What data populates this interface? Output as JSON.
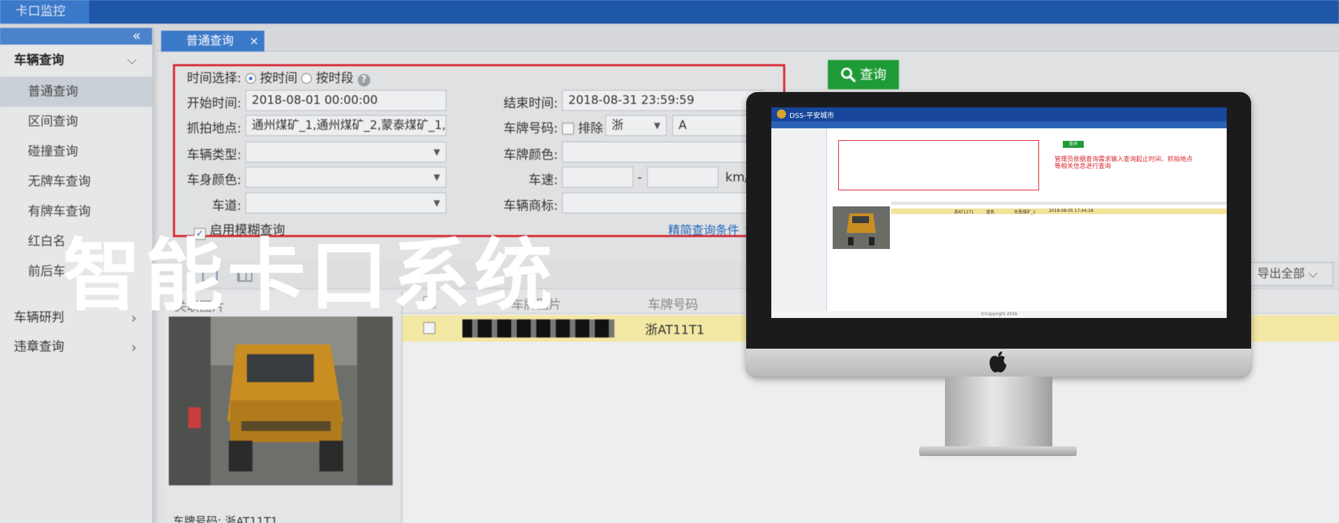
{
  "topbar": {
    "tab": "卡口监控"
  },
  "sidebar": {
    "collapse_icon": "«",
    "group_vehicle_query": "车辆查询",
    "items": [
      "普通查询",
      "区间查询",
      "碰撞查询",
      "无牌车查询",
      "有牌车查询",
      "红白名",
      "前后车"
    ],
    "group_vehicle_control": "车辆研判",
    "group_violation": "违章查询"
  },
  "tabs": {
    "active": "普通查询",
    "close": "×"
  },
  "form": {
    "time_select_label": "时间选择:",
    "radio_by_time": "按时间",
    "radio_by_segment": "按时段",
    "start_label": "开始时间:",
    "start_value": "2018-08-01 00:00:00",
    "end_label": "结束时间:",
    "end_value": "2018-08-31 23:59:59",
    "location_label": "抓拍地点:",
    "location_value": "通州煤矿_1,通州煤矿_2,蒙泰煤矿_1,",
    "plate_label": "车牌号码:",
    "exclude_label": "排除",
    "plate_province": "浙",
    "plate_value": "A",
    "vehicle_type_label": "车辆类型:",
    "plate_color_label": "车牌颜色:",
    "body_color_label": "车身颜色:",
    "speed_label": "车速:",
    "speed_sep": "-",
    "speed_unit": "km/h",
    "lane_label": "车道:",
    "brand_label": "车辆商标:",
    "fuzzy_label": "启用模糊查询",
    "advanced_label": "精简查询条件"
  },
  "search_button": "查询",
  "export_all": "导出全部",
  "list": {
    "left_header": "关联图片",
    "col_plate_image": "车牌图片",
    "col_plate_number": "车牌号码",
    "row_plate": "浙AT11T1",
    "detail_plate": "车牌号码: 浙AT11T1"
  },
  "overlay_title": "智能卡口系统",
  "monitor_screen": {
    "app_title": "DSS-平安城市",
    "note": "管理员依据查询需求输入查询起止时间、抓拍地点等相关信息进行查询",
    "search": "查询",
    "copyright": "©Copyright 2016",
    "plate": "浙AT11T1",
    "color": "蓝色",
    "location": "天恩煤矿_1",
    "time": "2018-08-05 17:44:18"
  },
  "colors": {
    "accent_blue": "#1e56a8",
    "highlight_red": "#d8262e",
    "search_green": "#1e9b36",
    "row_yellow": "#f3e7a4"
  }
}
